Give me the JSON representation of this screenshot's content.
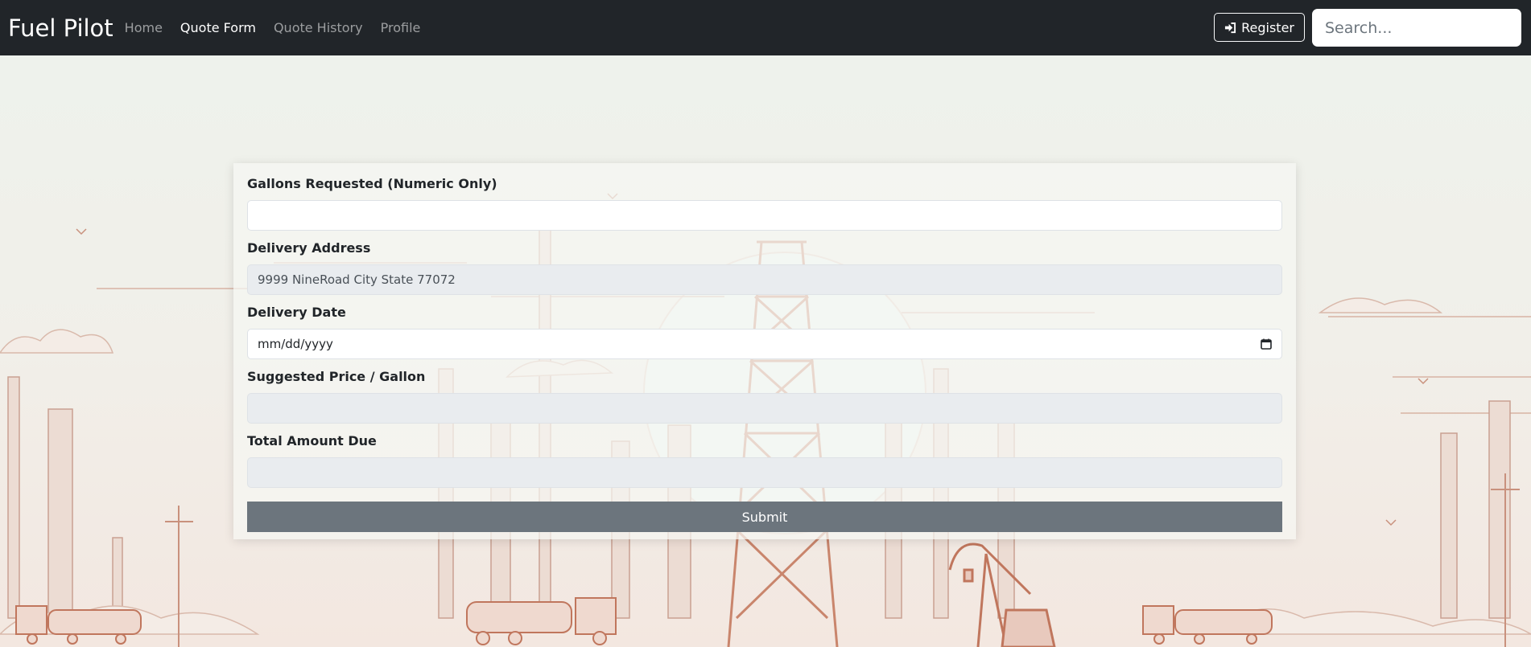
{
  "navbar": {
    "brand": "Fuel Pilot",
    "links": [
      {
        "label": "Home"
      },
      {
        "label": "Quote Form"
      },
      {
        "label": "Quote History"
      },
      {
        "label": "Profile"
      }
    ],
    "register_label": "Register",
    "search_placeholder": "Search..."
  },
  "form": {
    "gallons_label": "Gallons Requested (Numeric Only)",
    "gallons_value": "",
    "address_label": "Delivery Address",
    "address_value": "9999 NineRoad City State 77072",
    "date_label": "Delivery Date",
    "date_placeholder": "mm/dd/yyyy",
    "price_label": "Suggested Price / Gallon",
    "price_value": "",
    "total_label": "Total Amount Due",
    "total_value": "",
    "submit_label": "Submit"
  },
  "colors": {
    "navbar_bg": "#212529",
    "submit_bg": "#6c757d",
    "illustration_line": "#c9917d"
  },
  "icons": {
    "register": "sign-in-icon",
    "date": "calendar-icon"
  }
}
